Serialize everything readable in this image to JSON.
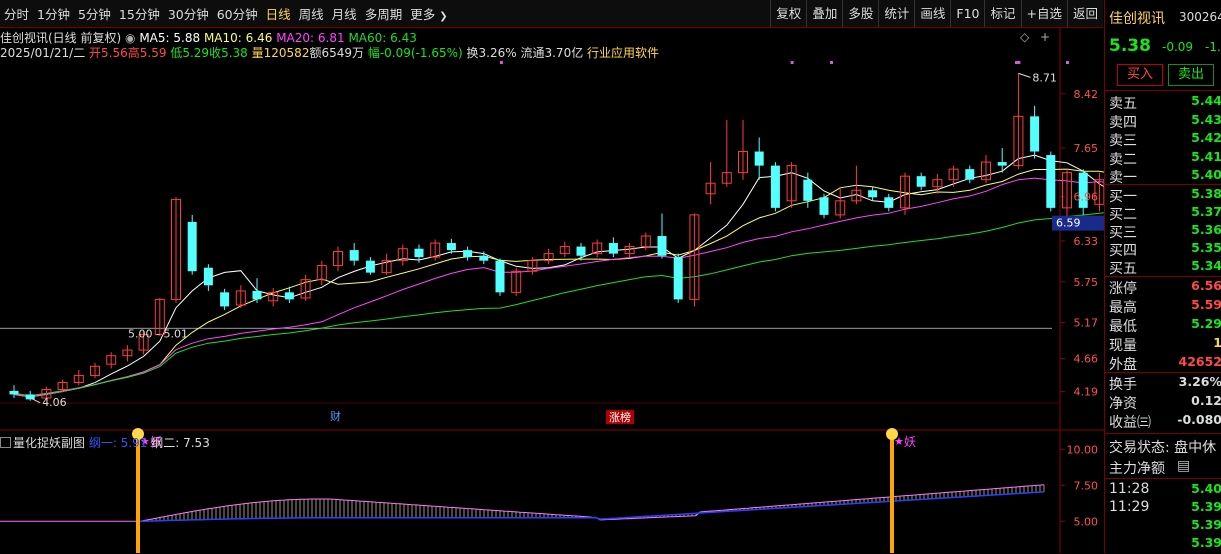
{
  "toolbar": {
    "timeframes": [
      "分时",
      "1分钟",
      "5分钟",
      "15分钟",
      "30分钟",
      "60分钟",
      "日线",
      "周线",
      "月线",
      "多周期",
      "更多"
    ],
    "more_arrow": "❯",
    "active": "日线",
    "buttons": [
      "复权",
      "叠加",
      "多股",
      "统计",
      "画线",
      "F10",
      "标记",
      "+自选",
      "返回"
    ]
  },
  "info": {
    "stock_head": "佳创视讯(日线 前复权)",
    "ma5": "MA5: 5.88",
    "ma10": "MA10: 6.46",
    "ma20": "MA20: 6.81",
    "ma60": "MA60: 6.43",
    "date": "2025/01/21/二",
    "open": "开5.56",
    "high": "高5.59",
    "low": "低5.29",
    "close": "收5.38",
    "vol": "量120582",
    "amt": "额6549万",
    "chg": "幅-0.09(-1.65%)",
    "turnover": "换3.26%",
    "float": "流通3.70亿",
    "industry": "行业应用软件"
  },
  "chart_data": {
    "type": "candlestick",
    "yticks": [
      "8.42",
      "7.65",
      "6.96",
      "6.33",
      "5.75",
      "5.17",
      "4.66",
      "4.19"
    ],
    "ytick_values": [
      8.42,
      7.65,
      6.96,
      6.33,
      5.75,
      5.17,
      4.66,
      4.19
    ],
    "ylim": [
      4.0,
      8.9
    ],
    "current_price_label": "6.59",
    "annotations": {
      "high": "8.71",
      "low": "4.06",
      "mid": "5.00 - 5.01",
      "cai": "财",
      "zhangbang": "涨榜"
    },
    "colors": {
      "up": "#ff3b3b",
      "down": "#54ffff",
      "ma5": "#ffffff",
      "ma10": "#ffff66",
      "ma20": "#ff44ff",
      "ma60": "#22dd22"
    },
    "candles": [
      [
        4.2,
        4.15,
        4.28,
        4.1
      ],
      [
        4.15,
        4.08,
        4.2,
        4.06
      ],
      [
        4.1,
        4.22,
        4.26,
        4.08
      ],
      [
        4.22,
        4.32,
        4.36,
        4.18
      ],
      [
        4.32,
        4.42,
        4.5,
        4.28
      ],
      [
        4.42,
        4.55,
        4.6,
        4.38
      ],
      [
        4.58,
        4.7,
        4.75,
        4.52
      ],
      [
        4.7,
        4.78,
        4.85,
        4.62
      ],
      [
        4.78,
        5.0,
        5.05,
        4.72
      ],
      [
        5.0,
        5.5,
        5.52,
        4.98
      ],
      [
        5.5,
        6.92,
        6.95,
        5.45
      ],
      [
        6.6,
        5.9,
        6.7,
        5.85
      ],
      [
        5.95,
        5.7,
        6.0,
        5.62
      ],
      [
        5.6,
        5.4,
        5.65,
        5.35
      ],
      [
        5.42,
        5.62,
        5.7,
        5.38
      ],
      [
        5.62,
        5.5,
        5.8,
        5.45
      ],
      [
        5.48,
        5.6,
        5.66,
        5.4
      ],
      [
        5.6,
        5.5,
        5.68,
        5.45
      ],
      [
        5.52,
        5.78,
        5.85,
        5.48
      ],
      [
        5.78,
        5.98,
        6.05,
        5.7
      ],
      [
        5.98,
        6.18,
        6.25,
        5.9
      ],
      [
        6.2,
        6.05,
        6.3,
        5.98
      ],
      [
        6.05,
        5.88,
        6.1,
        5.85
      ],
      [
        5.88,
        6.05,
        6.15,
        5.85
      ],
      [
        6.05,
        6.22,
        6.28,
        5.98
      ],
      [
        6.22,
        6.1,
        6.28,
        6.02
      ],
      [
        6.1,
        6.3,
        6.35,
        6.05
      ],
      [
        6.3,
        6.2,
        6.36,
        6.15
      ],
      [
        6.2,
        6.1,
        6.25,
        6.05
      ],
      [
        6.12,
        6.05,
        6.18,
        6.0
      ],
      [
        6.05,
        5.6,
        6.08,
        5.55
      ],
      [
        5.6,
        5.9,
        5.95,
        5.55
      ],
      [
        5.9,
        6.05,
        6.1,
        5.85
      ],
      [
        6.05,
        6.15,
        6.22,
        6.0
      ],
      [
        6.15,
        6.25,
        6.32,
        6.1
      ],
      [
        6.25,
        6.12,
        6.3,
        6.05
      ],
      [
        6.15,
        6.3,
        6.35,
        6.1
      ],
      [
        6.3,
        6.15,
        6.38,
        6.1
      ],
      [
        6.15,
        6.25,
        6.3,
        6.1
      ],
      [
        6.25,
        6.4,
        6.45,
        6.2
      ],
      [
        6.4,
        6.12,
        6.72,
        6.08
      ],
      [
        6.1,
        5.5,
        6.15,
        5.45
      ],
      [
        5.5,
        6.7,
        6.72,
        5.4
      ],
      [
        7.0,
        7.15,
        7.45,
        6.85
      ],
      [
        7.15,
        7.3,
        8.05,
        7.1
      ],
      [
        7.3,
        7.6,
        8.05,
        7.2
      ],
      [
        7.6,
        7.4,
        7.8,
        7.2
      ],
      [
        7.4,
        6.8,
        7.45,
        6.75
      ],
      [
        6.9,
        7.4,
        7.45,
        6.8
      ],
      [
        7.2,
        6.9,
        7.3,
        6.8
      ],
      [
        6.95,
        6.7,
        7.0,
        6.65
      ],
      [
        6.7,
        6.9,
        7.1,
        6.65
      ],
      [
        6.9,
        7.05,
        7.4,
        6.85
      ],
      [
        7.05,
        6.95,
        7.1,
        6.9
      ],
      [
        6.95,
        6.8,
        7.0,
        6.75
      ],
      [
        6.8,
        7.25,
        7.3,
        6.7
      ],
      [
        7.25,
        7.1,
        7.3,
        7.05
      ],
      [
        7.1,
        7.2,
        7.28,
        7.0
      ],
      [
        7.2,
        7.35,
        7.4,
        7.1
      ],
      [
        7.35,
        7.2,
        7.4,
        7.15
      ],
      [
        7.2,
        7.45,
        7.55,
        7.15
      ],
      [
        7.45,
        7.4,
        7.65,
        7.3
      ],
      [
        7.4,
        8.1,
        8.71,
        7.35
      ],
      [
        8.1,
        7.6,
        8.25,
        7.5
      ],
      [
        7.55,
        6.8,
        7.6,
        6.75
      ],
      [
        6.8,
        7.3,
        7.35,
        6.55
      ],
      [
        7.3,
        6.8,
        7.35,
        6.7
      ],
      [
        6.85,
        7.2,
        7.3,
        6.75
      ],
      [
        7.1,
        6.9,
        7.2,
        6.85
      ],
      [
        6.9,
        6.35,
        6.95,
        6.3
      ],
      [
        6.35,
        6.1,
        6.4,
        6.05
      ],
      [
        6.05,
        5.85,
        6.05,
        5.8
      ],
      [
        5.85,
        5.7,
        5.92,
        5.55
      ],
      [
        5.72,
        5.78,
        5.86,
        5.7
      ],
      [
        5.56,
        5.38,
        5.59,
        5.29
      ]
    ],
    "sub": {
      "legend_name": "量化捉妖副图",
      "line1": "纲一: 5.91",
      "line2": "纲二: 7.53",
      "yticks": [
        "10.00",
        "7.50",
        "5.00"
      ],
      "ytick_values": [
        10,
        7.5,
        5
      ],
      "ylim": [
        2.8,
        11.2
      ],
      "signal_label": "妖",
      "signal_index": [
        10,
        62
      ]
    }
  },
  "right": {
    "name": "佳创视讯",
    "code": "300264",
    "price": "5.38",
    "change": "-0.09",
    "change_pct": "-1.6",
    "buy_btn": "买入",
    "sell_btn": "卖出",
    "asks": [
      [
        "卖五",
        "5.44"
      ],
      [
        "卖四",
        "5.43"
      ],
      [
        "卖三",
        "5.42"
      ],
      [
        "卖二",
        "5.41"
      ],
      [
        "卖一",
        "5.40"
      ]
    ],
    "bids": [
      [
        "买一",
        "5.38"
      ],
      [
        "买二",
        "5.37"
      ],
      [
        "买三",
        "5.36"
      ],
      [
        "买四",
        "5.35"
      ],
      [
        "买五",
        "5.34"
      ]
    ],
    "stats": [
      [
        "涨停",
        "6.56"
      ],
      [
        "最高",
        "5.59"
      ],
      [
        "最低",
        "5.29"
      ],
      [
        "现量",
        "1"
      ],
      [
        "外盘",
        "42652"
      ]
    ],
    "stats2": [
      [
        "换手",
        "3.26%"
      ],
      [
        "净资",
        "0.12"
      ],
      [
        "收益㈢",
        "-0.080"
      ]
    ],
    "trade_state": "交易状态: 盘中休",
    "main_net": "主力净额",
    "ticks": [
      [
        "11:28",
        "5.40"
      ],
      [
        "11:29",
        "5.39"
      ],
      [
        "",
        "5.39"
      ],
      [
        "",
        "5.39"
      ]
    ]
  }
}
